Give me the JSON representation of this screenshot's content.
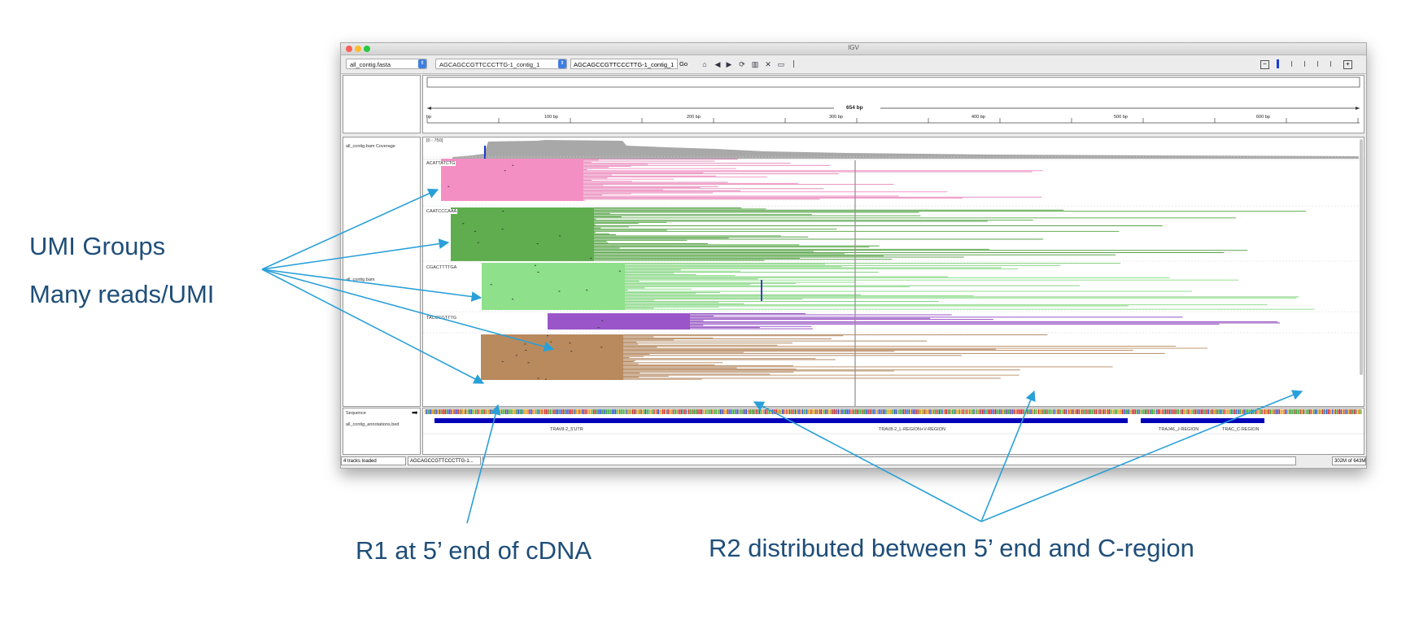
{
  "window": {
    "title": "IGV"
  },
  "toolbar": {
    "genome": "all_contig.fasta",
    "chromosome": "AGCAGCCGTTCCCTTG-1_contig_1",
    "locus": "AGCAGCCGTTCCCTTG-1_contig_1",
    "go_label": "Go",
    "icons": [
      "home-icon",
      "back-icon",
      "forward-icon",
      "refresh-icon",
      "roi-icon",
      "close-icon",
      "popup-text-icon"
    ],
    "zoom_icons": [
      "zoom-out-icon",
      "zoom-in-icon"
    ]
  },
  "ruler": {
    "length_label": "654 bp",
    "start_label": "bp",
    "ticks": [
      "100 bp",
      "200 bp",
      "300 bp",
      "400 bp",
      "500 bp",
      "600 bp"
    ]
  },
  "tracks": {
    "coverage_name": "all_contig.bam Coverage",
    "coverage_range": "[0 - 750]",
    "bam_name": "all_contig.bam",
    "sequence_name": "Sequence",
    "annotations_name": "all_contig_annotations.bed",
    "umi_groups": [
      {
        "label": "ACATTATCTG",
        "color": "#f48fc4"
      },
      {
        "label": "CAATCCCAAA",
        "color": "#5fad4e"
      },
      {
        "label": "CGACTTTTGA",
        "color": "#8ee08a"
      },
      {
        "label": "TACCCGTTTG",
        "color": "#9a55c9"
      },
      {
        "label": "",
        "color": "#b98a5e"
      }
    ],
    "features": [
      "TRAV8-2_5'UTR",
      "TRAV8-2_L-REGION+V-REGION",
      "TRAJ46_J-REGION",
      "TRAC_C-REGION"
    ]
  },
  "status": {
    "tracks_loaded": "4 tracks loaded",
    "position": "AGCAGCCGTTCCCTTG-1...",
    "memory": "302M of 643M"
  },
  "annotations": {
    "umi_groups": "UMI Groups",
    "many_reads": "Many reads/UMI",
    "r1": "R1 at 5’ end of cDNA",
    "r2": "R2 distributed between 5’ end and C-region"
  },
  "colors": {
    "arrow": "#2aa0d8",
    "callout_text": "#1f4e79",
    "feature_bar": "#0000b8"
  }
}
